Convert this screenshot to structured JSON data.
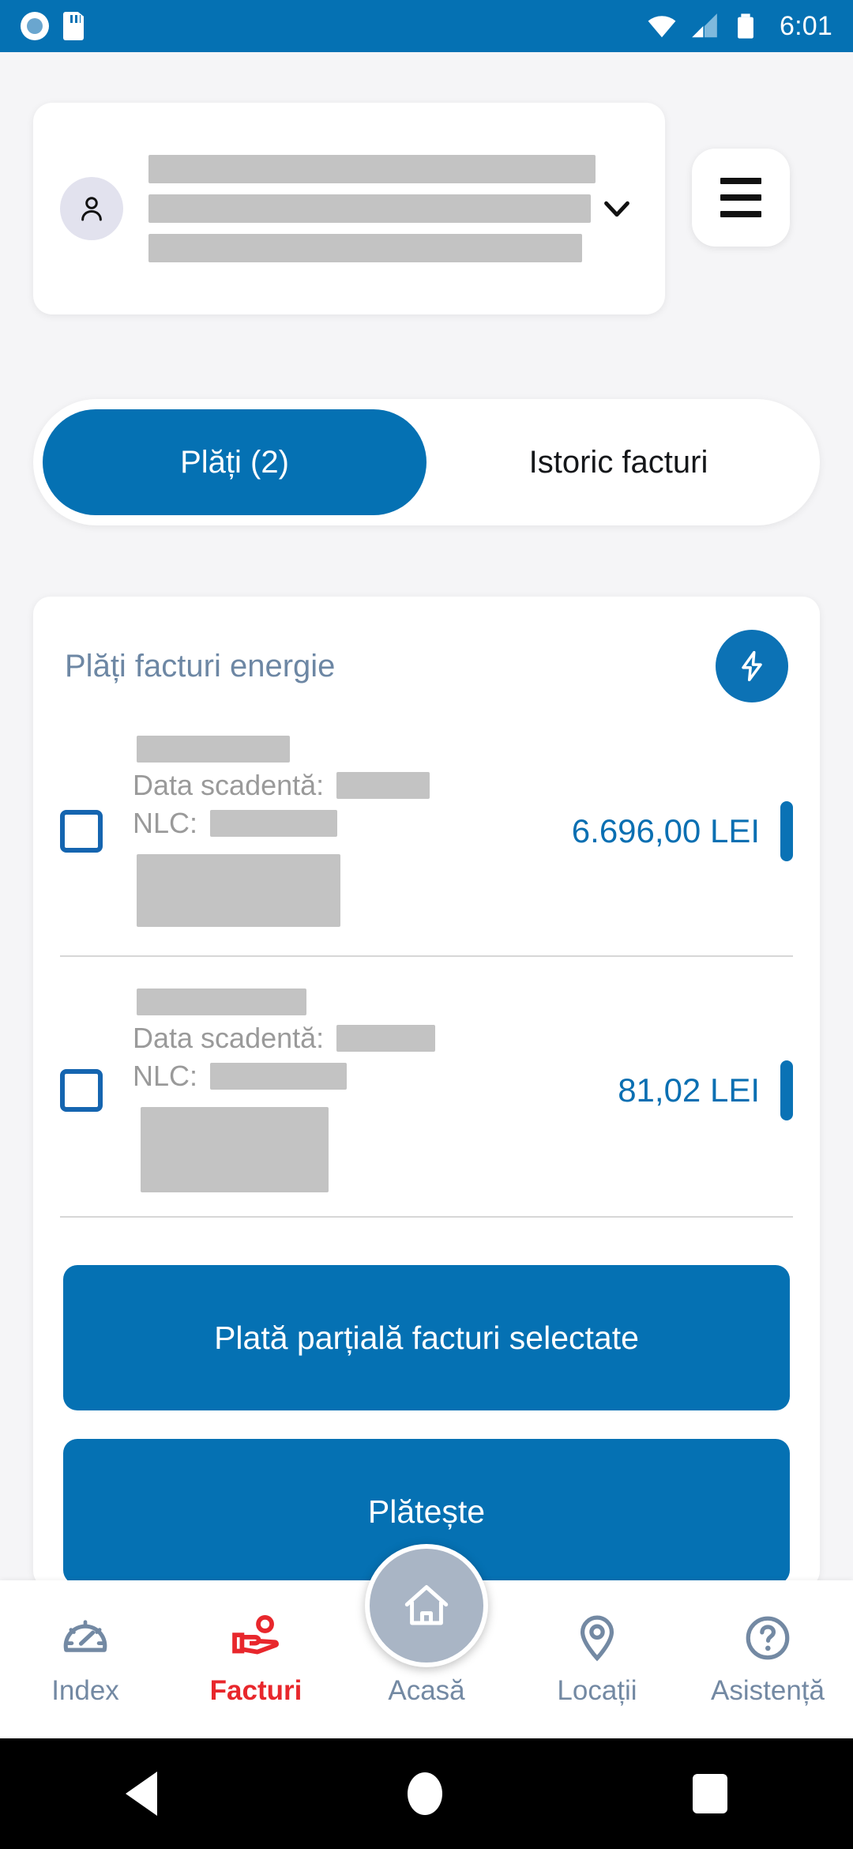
{
  "status_bar": {
    "time": "6:01",
    "icons": [
      "screen-record-icon",
      "sd-card-icon",
      "wifi-icon",
      "cellular-signal-icon",
      "battery-icon"
    ],
    "background_color": "#0571b3"
  },
  "account": {
    "avatar_icon": "person-icon",
    "redacted_lines": 3,
    "expand_icon": "chevron-down-icon",
    "menu_icon": "hamburger-menu-icon"
  },
  "tabs": [
    {
      "label": "Plăți (2)",
      "active": true
    },
    {
      "label": "Istoric facturi",
      "active": false
    }
  ],
  "payments_card": {
    "title": "Plăți facturi energie",
    "badge_icon": "lightning-bolt-icon",
    "badge_color": "#0c72b5",
    "due_date_label": "Data scadentă:",
    "nlc_label": "NLC:",
    "invoices": [
      {
        "amount": "6.696,00 LEI",
        "checked": false
      },
      {
        "amount": "81,02 LEI",
        "checked": false
      }
    ],
    "buttons": [
      {
        "label": "Plată parțială facturi selectate"
      },
      {
        "label": "Plătește"
      }
    ]
  },
  "bottom_nav": {
    "fab": {
      "icon": "home-icon",
      "label": ""
    },
    "items": [
      {
        "label": "Index",
        "icon": "gauge-icon",
        "active": false
      },
      {
        "label": "Facturi",
        "icon": "hand-holding-coin-icon",
        "active": true
      },
      {
        "label": "Acasă",
        "icon": "home-icon",
        "active": false
      },
      {
        "label": "Locații",
        "icon": "map-pin-icon",
        "active": false
      },
      {
        "label": "Asistență",
        "icon": "question-circle-icon",
        "active": false
      }
    ],
    "active_color": "#e8272c",
    "inactive_color": "#7389a3"
  },
  "android_nav": {
    "back_icon": "triangle-back-icon",
    "home_icon": "circle-home-icon",
    "recents_icon": "square-recents-icon"
  }
}
